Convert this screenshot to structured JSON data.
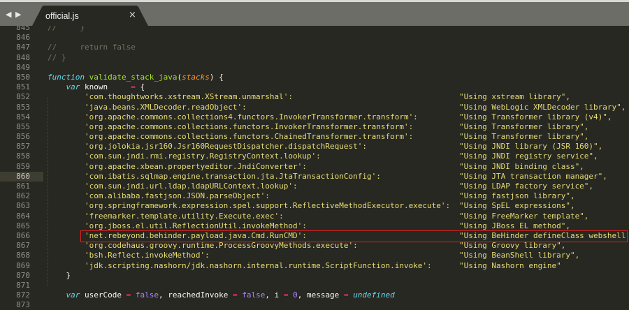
{
  "tab": {
    "title": "official.js",
    "close": "×",
    "back": "◀",
    "forward": "▶"
  },
  "highlight_color": "#e0201f",
  "current_line": 860,
  "lines": [
    {
      "n": "845",
      "tokens": [
        [
          "comment",
          "//     }"
        ]
      ]
    },
    {
      "n": "846",
      "tokens": []
    },
    {
      "n": "847",
      "tokens": [
        [
          "comment",
          "//     return false"
        ]
      ]
    },
    {
      "n": "848",
      "tokens": [
        [
          "comment",
          "// }"
        ]
      ]
    },
    {
      "n": "849",
      "tokens": []
    },
    {
      "n": "850",
      "tokens": [
        [
          "kw",
          "function"
        ],
        [
          "plain",
          " "
        ],
        [
          "fn",
          "validate_stack_java"
        ],
        [
          "plain",
          "("
        ],
        [
          "param",
          "stacks"
        ],
        [
          "plain",
          ") {"
        ]
      ]
    },
    {
      "n": "851",
      "tokens": [
        [
          "plain",
          "    "
        ],
        [
          "kw",
          "var"
        ],
        [
          "plain",
          " known     "
        ],
        [
          "op",
          "="
        ],
        [
          "plain",
          " {"
        ]
      ]
    },
    {
      "n": "852",
      "key": "'com.thoughtworks.xstream.XStream.unmarshal':",
      "value": "\"Using xstream library\","
    },
    {
      "n": "853",
      "key": "'java.beans.XMLDecoder.readObject':",
      "value": "\"Using WebLogic XMLDecoder library\","
    },
    {
      "n": "854",
      "key": "'org.apache.commons.collections4.functors.InvokerTransformer.transform':",
      "value": "\"Using Transformer library (v4)\","
    },
    {
      "n": "855",
      "key": "'org.apache.commons.collections.functors.InvokerTransformer.transform':",
      "value": "\"Using Transformer library\","
    },
    {
      "n": "856",
      "key": "'org.apache.commons.collections.functors.ChainedTransformer.transform':",
      "value": "\"Using Transformer library\","
    },
    {
      "n": "857",
      "key": "'org.jolokia.jsr160.Jsr160RequestDispatcher.dispatchRequest':",
      "value": "\"Using JNDI library (JSR 160)\","
    },
    {
      "n": "858",
      "key": "'com.sun.jndi.rmi.registry.RegistryContext.lookup':",
      "value": "\"Using JNDI registry service\","
    },
    {
      "n": "859",
      "key": "'org.apache.xbean.propertyeditor.JndiConverter':",
      "value": "\"Using JNDI binding class\","
    },
    {
      "n": "860",
      "key": "'com.ibatis.sqlmap.engine.transaction.jta.JtaTransactionConfig':",
      "value": "\"Using JTA transaction manager\","
    },
    {
      "n": "861",
      "key": "'com.sun.jndi.url.ldap.ldapURLContext.lookup':",
      "value": "\"Using LDAP factory service\","
    },
    {
      "n": "862",
      "key": "'com.alibaba.fastjson.JSON.parseObject':",
      "value": "\"Using fastjson library\","
    },
    {
      "n": "863",
      "key": "'org.springframework.expression.spel.support.ReflectiveMethodExecutor.execute':",
      "value": "\"Using SpEL expressions\","
    },
    {
      "n": "864",
      "key": "'freemarker.template.utility.Execute.exec':",
      "value": "\"Using FreeMarker template\","
    },
    {
      "n": "865",
      "key": "'org.jboss.el.util.ReflectionUtil.invokeMethod':",
      "value": "\"Using JBoss EL method\","
    },
    {
      "n": "866",
      "key": "'net.rebeyond.behinder.payload.java.Cmd.RunCMD':",
      "value": "\"Using BeHinder defineClass webshell"
    },
    {
      "n": "867",
      "key": "'org.codehaus.groovy.runtime.ProcessGroovyMethods.execute':",
      "value": "\"Using Groovy library\","
    },
    {
      "n": "868",
      "key": "'bsh.Reflect.invokeMethod':",
      "value": "\"Using BeanShell library\","
    },
    {
      "n": "869",
      "key": "'jdk.scripting.nashorn/jdk.nashorn.internal.runtime.ScriptFunction.invoke':",
      "value": "\"Using Nashorn engine\""
    },
    {
      "n": "870",
      "tokens": [
        [
          "plain",
          "    }"
        ]
      ]
    },
    {
      "n": "871",
      "tokens": []
    },
    {
      "n": "872",
      "tokens": [
        [
          "plain",
          "    "
        ],
        [
          "kw",
          "var"
        ],
        [
          "plain",
          " userCode "
        ],
        [
          "op",
          "="
        ],
        [
          "plain",
          " "
        ],
        [
          "const",
          "false"
        ],
        [
          "plain",
          ", reachedInvoke "
        ],
        [
          "op",
          "="
        ],
        [
          "plain",
          " "
        ],
        [
          "const",
          "false"
        ],
        [
          "plain",
          ", i "
        ],
        [
          "op",
          "="
        ],
        [
          "plain",
          " "
        ],
        [
          "const",
          "0"
        ],
        [
          "plain",
          ", message "
        ],
        [
          "op",
          "="
        ],
        [
          "plain",
          " "
        ],
        [
          "kw",
          "undefined"
        ]
      ]
    },
    {
      "n": "873",
      "tokens": []
    }
  ]
}
